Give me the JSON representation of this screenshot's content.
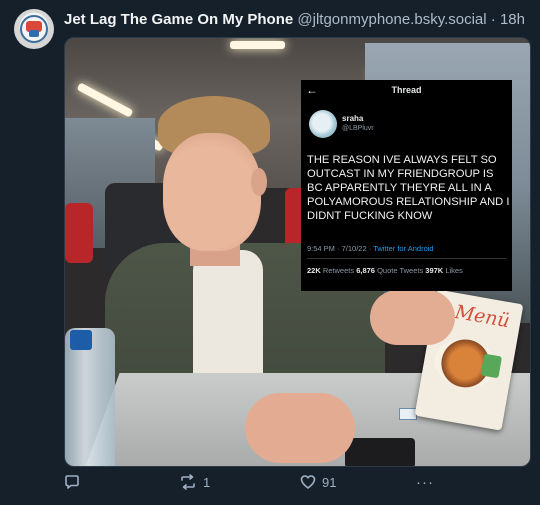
{
  "author": {
    "display_name": "Jet Lag The Game On My Phone",
    "handle": "@jltgonmyphone.bsky.social",
    "separator": "·",
    "time_ago": "18h",
    "avatar_icon": "jet-lag-logo"
  },
  "media": {
    "embedded_tweet": {
      "back_icon": "arrow-left-icon",
      "back_glyph": "←",
      "header": "Thread",
      "name": "sraha",
      "handle": "@LBPluvr",
      "text": "THE REASON IVE ALWAYS FELT SO OUTCAST IN MY FRIENDGROUP IS BC APPARENTLY THEYRE ALL IN A POLYAMOROUS RELATIONSHIP AND I DIDNT FUCKING KNOW",
      "timestamp": "9:54 PM · 7/10/22 · ",
      "app": "Twitter for Android",
      "retweets_value": "22K",
      "retweets_label": " Retweets  ",
      "quotes_value": "6,876",
      "quotes_label": " Quote Tweets  ",
      "likes_value": "397K",
      "likes_label": " Likes"
    },
    "menu_card_title": "Menü"
  },
  "actions": {
    "reply": {
      "icon": "reply-icon",
      "count": ""
    },
    "repost": {
      "icon": "repost-icon",
      "count": "1"
    },
    "like": {
      "icon": "heart-icon",
      "count": "91"
    },
    "more": {
      "icon": "more-icon",
      "label": "···"
    }
  },
  "colors": {
    "background": "#16202b",
    "text": "#f1f3f5",
    "muted": "#aebbc9",
    "twitter_blue": "#1d9bf0"
  }
}
